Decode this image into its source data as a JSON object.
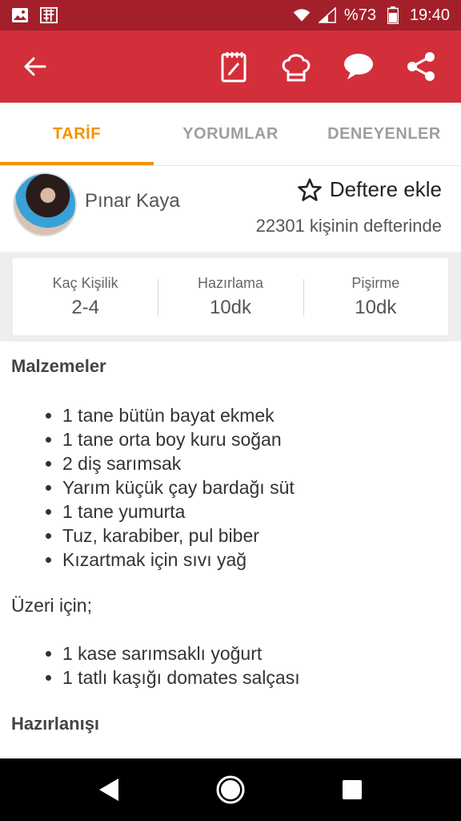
{
  "status_bar": {
    "battery_percent": "%73",
    "time": "19:40",
    "icons": [
      "image-icon",
      "app-notification-icon",
      "wifi-icon",
      "signal-icon",
      "battery-icon"
    ]
  },
  "app_bar": {
    "color": "#d32f3a",
    "actions": [
      "notebook-icon",
      "chef-hat-icon",
      "comment-icon",
      "share-icon"
    ]
  },
  "tabs": [
    {
      "label": "TARİF",
      "active": true
    },
    {
      "label": "YORUMLAR",
      "active": false
    },
    {
      "label": "DENEYENLER",
      "active": false
    }
  ],
  "author": {
    "name": "Pınar Kaya"
  },
  "save": {
    "label": "Deftere ekle",
    "count_text": "22301 kişinin defterinde"
  },
  "info": [
    {
      "label": "Kaç Kişilik",
      "value": "2-4"
    },
    {
      "label": "Hazırlama",
      "value": "10dk"
    },
    {
      "label": "Pişirme",
      "value": "10dk"
    }
  ],
  "content": {
    "ingredients_title": "Malzemeler",
    "ingredients": [
      "1 tane bütün bayat ekmek",
      "1 tane orta boy kuru soğan",
      "2 diş sarımsak",
      "Yarım küçük çay bardağı süt",
      "1 tane yumurta",
      "Tuz, karabiber, pul biber",
      "Kızartmak için sıvı yağ"
    ],
    "topping_title": "Üzeri için;",
    "topping": [
      "1 kase sarımsaklı yoğurt",
      "1 tatlı kaşığı domates salçası"
    ],
    "preparation_title": "Hazırlanışı"
  },
  "colors": {
    "status_bar": "#a3202a",
    "accent": "#f39200"
  }
}
